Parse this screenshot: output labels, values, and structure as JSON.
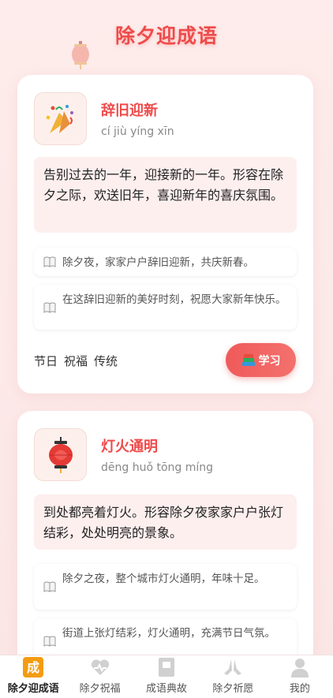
{
  "page": {
    "title": "除夕迎成语"
  },
  "cards": [
    {
      "idiom": "辞旧迎新",
      "pinyin": "cí jiù yíng xīn",
      "icon": "party-popper-icon",
      "meaning": "告别过去的一年，迎接新的一年。形容在除夕之际，欢送旧年，喜迎新年的喜庆氛围。",
      "examples": [
        "除夕夜，家家户户辞旧迎新，共庆新春。",
        "在这辞旧迎新的美好时刻，祝愿大家新年快乐。"
      ],
      "tags": [
        "节日",
        "祝福",
        "传统"
      ],
      "learn_label": "学习"
    },
    {
      "idiom": "灯火通明",
      "pinyin": "dēng huǒ tōng míng",
      "icon": "lantern-icon",
      "meaning": "到处都亮着灯火。形容除夕夜家家户户张灯结彩，处处明亮的景象。",
      "examples": [
        "除夕之夜，整个城市灯火通明，年味十足。",
        "街道上张灯结彩，灯火通明，充满节日气氛。"
      ]
    }
  ],
  "tabbar": {
    "items": [
      {
        "label": "除夕迎成语",
        "icon": "idiom-icon",
        "active": true
      },
      {
        "label": "除夕祝福",
        "icon": "heart-icon",
        "active": false
      },
      {
        "label": "成语典故",
        "icon": "book-icon",
        "active": false
      },
      {
        "label": "除夕祈愿",
        "icon": "pray-icon",
        "active": false
      },
      {
        "label": "我的",
        "icon": "user-icon",
        "active": false
      }
    ]
  },
  "colors": {
    "accent": "#ef4b4b",
    "background": "#fdeceb"
  }
}
